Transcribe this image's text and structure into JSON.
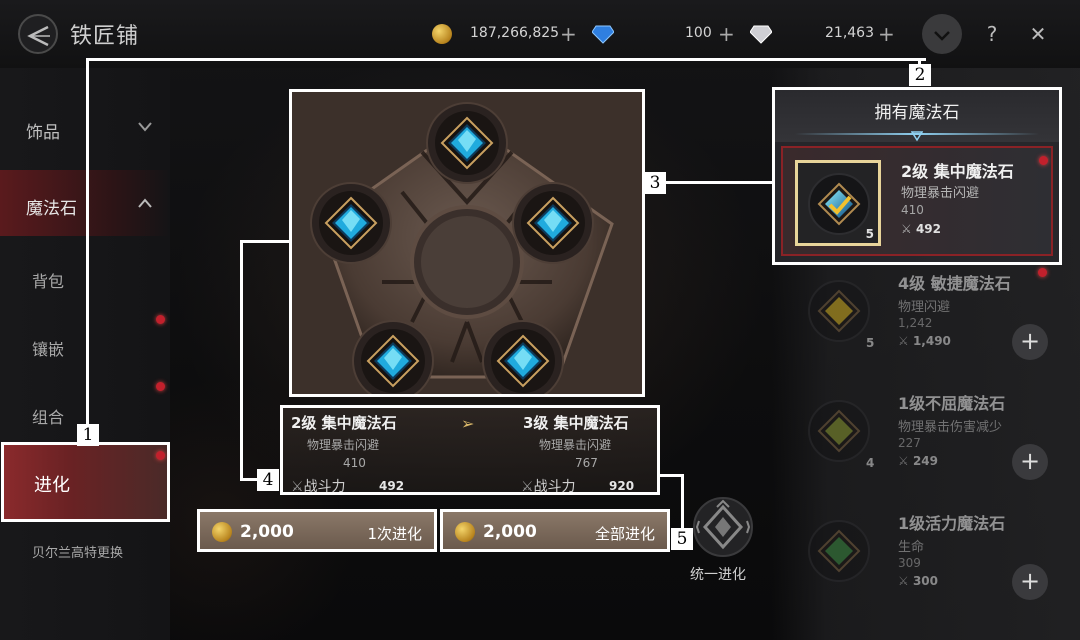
{
  "header": {
    "title": "铁匠铺",
    "gold": "187,266,825",
    "blue_gems": "100",
    "white_gems": "21,463",
    "plus": "+",
    "help": "?",
    "close": "✕"
  },
  "sidebar": {
    "items": [
      {
        "label": "饰品"
      },
      {
        "label": "魔法石"
      },
      {
        "label": "背包"
      },
      {
        "label": "镶嵌"
      },
      {
        "label": "组合"
      },
      {
        "label": "进化"
      },
      {
        "label": "贝尔兰高特更换"
      }
    ]
  },
  "upgrade": {
    "from": {
      "name": "2级 集中魔法石",
      "attr": "物理暴击闪避",
      "value": "410",
      "power_label": "战斗力",
      "power": "492"
    },
    "to": {
      "name": "3级 集中魔法石",
      "attr": "物理暴击闪避",
      "value": "767",
      "power_label": "战斗力",
      "power": "920"
    }
  },
  "buttons": {
    "single": {
      "cost": "2,000",
      "label": "1次进化"
    },
    "all": {
      "cost": "2,000",
      "label": "全部进化"
    },
    "unify": "统一进化"
  },
  "owned": {
    "title": "拥有魔法石",
    "items": [
      {
        "name": "2级 集中魔法石",
        "attr": "物理暴击闪避",
        "value": "410",
        "power": "492",
        "qty": "5",
        "color": "#2a8fe0"
      },
      {
        "name": "4级 敏捷魔法石",
        "attr": "物理闪避",
        "value": "1,242",
        "power": "1,490",
        "qty": "5",
        "color": "#d4b020"
      },
      {
        "name": "1级不屈魔法石",
        "attr": "物理暴击伤害减少",
        "value": "227",
        "power": "249",
        "qty": "4",
        "color": "#8a9a30"
      },
      {
        "name": "1级活力魔法石",
        "attr": "生命",
        "value": "309",
        "power": "300",
        "qty": "",
        "color": "#3a8a40"
      }
    ]
  },
  "tags": [
    "1",
    "2",
    "3",
    "4",
    "5"
  ],
  "colors": {
    "accent_red": "#8a2a2c",
    "gem_blue": "#3ad0f0",
    "gold": "#d9b86a"
  }
}
